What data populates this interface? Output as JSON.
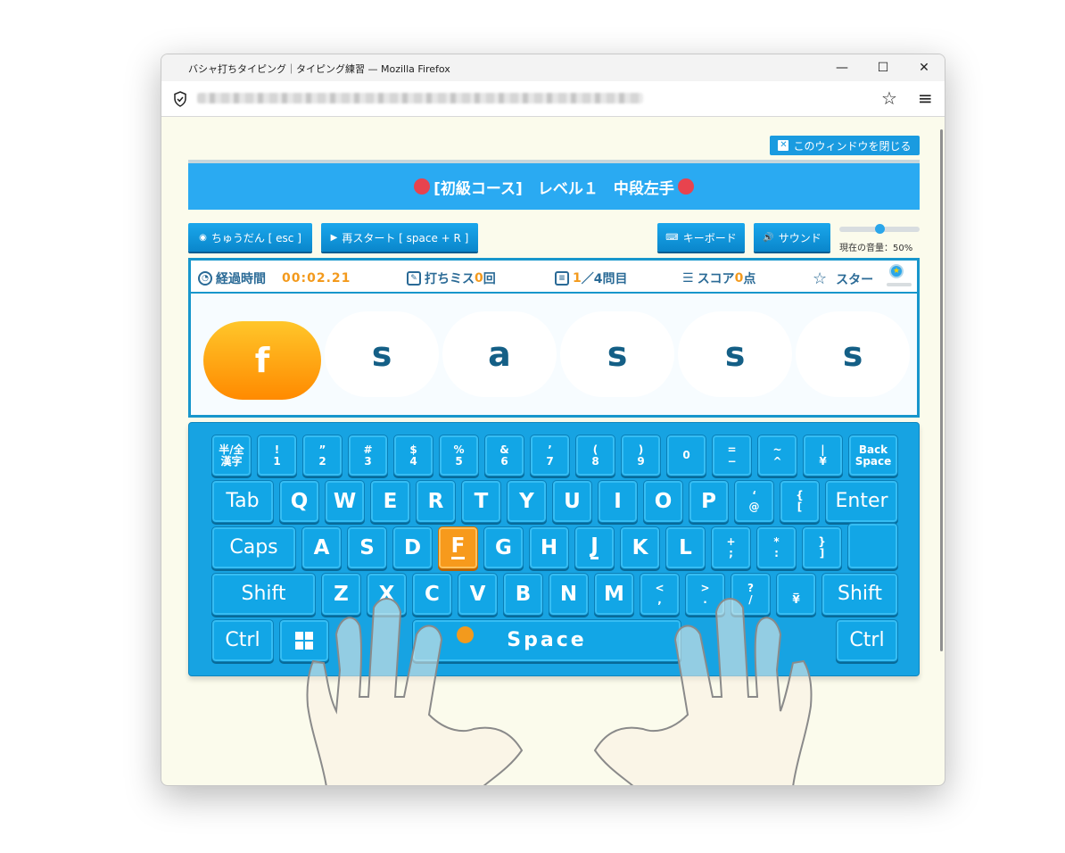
{
  "window": {
    "title": "バシャ打ちタイピング｜タイピング練習 — Mozilla Firefox",
    "minimize_glyph": "—",
    "maximize_glyph": "☐",
    "close_glyph": "✕"
  },
  "browser": {
    "url": "",
    "shield_icon": "shield-check-icon",
    "bookmark_glyph": "☆",
    "menu_glyph": "≡"
  },
  "page": {
    "close_window_label": "このウィンドウを閉じる",
    "course_title": "[初級コース]　レベル１　中段左手",
    "buttons": {
      "pause": "ちゅうだん [ esc ]",
      "restart": "再スタート [ space + R ]",
      "keyboard": "キーボード",
      "sound": "サウンド"
    },
    "volume": {
      "label": "現在の音量：50%",
      "value": 0.5
    },
    "stats": {
      "elapsed_label": "経過時間",
      "elapsed_value": "00:02.21",
      "miss_label": "打ちミス",
      "miss_value": "0",
      "miss_unit": "回",
      "progress_current": "1",
      "progress_rest": "／4問目",
      "score_label": "スコア",
      "score_value": "0",
      "score_unit": "点",
      "star_label": "スター"
    },
    "chips": [
      "f",
      "s",
      "a",
      "s",
      "s",
      "s"
    ],
    "active_chip_index": 0,
    "highlighted_key": "F",
    "accent_color": "#f39a1d",
    "keyboard_color": "#17a3e2"
  },
  "keyboard": {
    "row1": [
      {
        "top": "半/全",
        "bottom": "漢字"
      },
      {
        "top": "!",
        "bottom": "1"
      },
      {
        "top": "”",
        "bottom": "2"
      },
      {
        "top": "#",
        "bottom": "3"
      },
      {
        "top": "$",
        "bottom": "4"
      },
      {
        "top": "%",
        "bottom": "5"
      },
      {
        "top": "&",
        "bottom": "6"
      },
      {
        "top": "’",
        "bottom": "7"
      },
      {
        "top": "(",
        "bottom": "8"
      },
      {
        "top": ")",
        "bottom": "9"
      },
      {
        "top": "",
        "bottom": "0"
      },
      {
        "top": "=",
        "bottom": "−"
      },
      {
        "top": "~",
        "bottom": "^"
      },
      {
        "top": "|",
        "bottom": "¥"
      },
      {
        "top": "Back",
        "bottom": "Space"
      }
    ],
    "row2": [
      "Tab",
      "Q",
      "W",
      "E",
      "R",
      "T",
      "Y",
      "U",
      "I",
      "O",
      "P",
      {
        "top": "‘",
        "bottom": "@"
      },
      {
        "top": "{",
        "bottom": "["
      },
      "Enter"
    ],
    "row3": [
      "Caps",
      "A",
      "S",
      "D",
      "F",
      "G",
      "H",
      "J",
      "K",
      "L",
      {
        "top": "+",
        "bottom": ";"
      },
      {
        "top": "*",
        "bottom": ":"
      },
      {
        "top": "}",
        "bottom": "]"
      }
    ],
    "row4": [
      "Shift",
      "Z",
      "X",
      "C",
      "V",
      "B",
      "N",
      "M",
      {
        "top": "<",
        "bottom": ","
      },
      {
        "top": ">",
        "bottom": "."
      },
      {
        "top": "?",
        "bottom": "/"
      },
      {
        "top": "_",
        "bottom": "¥"
      },
      "Shift"
    ],
    "row5": [
      "Ctrl",
      "windows-icon",
      "Space",
      "Ctrl"
    ]
  }
}
